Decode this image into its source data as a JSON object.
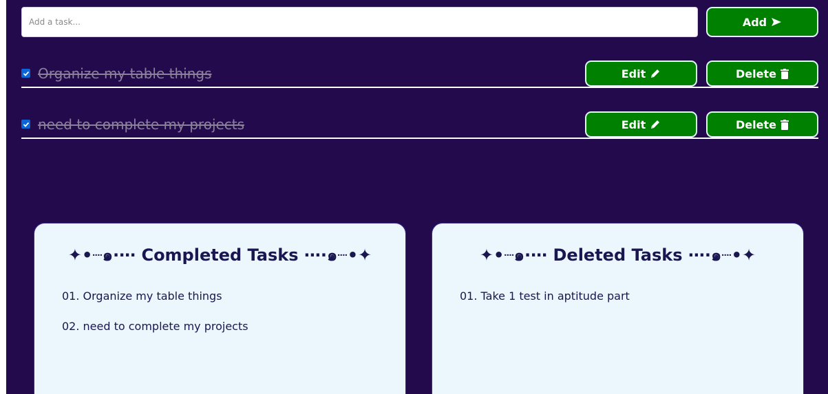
{
  "add_row": {
    "placeholder": "Add a task...",
    "value": "",
    "add_label": "Add",
    "add_icon": "send-arrow-icon"
  },
  "tasks": [
    {
      "text": "Organize my table things",
      "checked": true,
      "edit_label": "Edit",
      "delete_label": "Delete"
    },
    {
      "text": "need to complete my projects",
      "checked": true,
      "edit_label": "Edit",
      "delete_label": "Delete"
    }
  ],
  "completed": {
    "title": "✦•┈๑⋅⋯ Completed Tasks ⋯⋅๑┈•✦",
    "items": [
      "01. Organize my table things",
      "02. need to complete my projects"
    ]
  },
  "deleted": {
    "title": "✦•┈๑⋅⋯ Deleted Tasks ⋯⋅๑┈•✦",
    "items": [
      "01. Take 1 test in aptitude part"
    ]
  },
  "colors": {
    "background": "#230a4c",
    "button": "#008000",
    "card": "#ecf6fd",
    "card_text": "#1a1650",
    "done_text": "#8b8199"
  }
}
